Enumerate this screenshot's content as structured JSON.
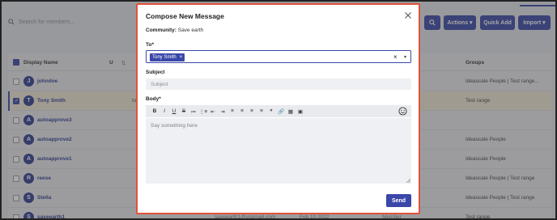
{
  "background": {
    "search_placeholder": "Search for members...",
    "buttons": {
      "actions": "Actions ▾",
      "quick_add": "Quick Add",
      "import": "Import ▾"
    },
    "table": {
      "columns": {
        "display_name": "Display Name",
        "sort_glyph": "⇅",
        "u": "U",
        "groups": "Groups"
      },
      "rows": [
        {
          "initial": "J",
          "name": "johndoe",
          "extra": "",
          "group": "Ideascale People | Test range...",
          "checked": false
        },
        {
          "initial": "T",
          "name": "Tony Smith",
          "extra": "to",
          "group": "Test range",
          "checked": true
        },
        {
          "initial": "A",
          "name": "autoapprove3",
          "extra": "",
          "group": "",
          "checked": false
        },
        {
          "initial": "A",
          "name": "autoapprove2",
          "extra": "",
          "group": "Ideascale People",
          "checked": false
        },
        {
          "initial": "A",
          "name": "autoapprove1",
          "extra": "",
          "group": "Ideascale People",
          "checked": false
        },
        {
          "initial": "R",
          "name": "reese",
          "extra": "",
          "group": "Ideascale People | Test range",
          "checked": false
        },
        {
          "initial": "S",
          "name": "Stella",
          "extra": "",
          "group": "Ideascale People | Test range",
          "checked": false
        },
        {
          "initial": "S",
          "name": "saveearth1",
          "extra": "saveearth1@yopmail.com",
          "group": "Test range",
          "checked": false
        }
      ],
      "last_row_date": "Feb 10 2022",
      "last_row_role": "Member"
    }
  },
  "modal": {
    "title": "Compose New Message",
    "community_label": "Community:",
    "community_value": "Save earth",
    "to_label": "To*",
    "to_chip": "Tony Smith",
    "chip_remove": "×",
    "clear_glyph": "×",
    "caret_glyph": "▾",
    "subject_label": "Subject",
    "subject_placeholder": "Subject",
    "body_label": "Body*",
    "body_placeholder": "Say something here",
    "send_label": "Send",
    "toolbar": [
      "B",
      "I",
      "U",
      "S",
      "≔",
      "⋮≡",
      "⇤",
      "⇥",
      "≡",
      "≡",
      "≡",
      "≡",
      "❞",
      "🔗",
      "▦",
      "▣"
    ]
  }
}
